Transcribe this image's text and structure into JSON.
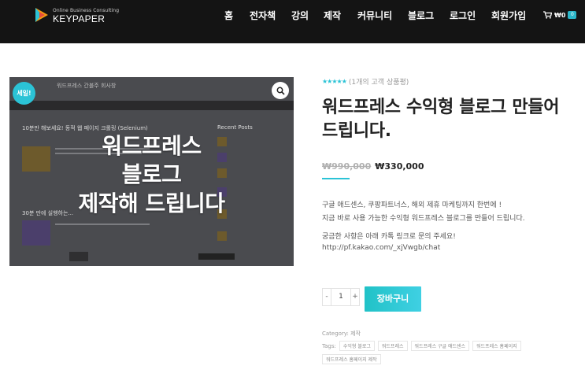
{
  "header": {
    "logo_tagline": "Online Business Consulting",
    "logo_name": "KEYPAPER",
    "nav": [
      "홈",
      "전자책",
      "강의",
      "제작",
      "커뮤니티",
      "블로그",
      "로그인",
      "회원가입"
    ],
    "cart_amount": "₩0",
    "cart_count": "0"
  },
  "product_image": {
    "sale_badge": "세일!",
    "overlay_lines": [
      "워드프레스",
      "블로그",
      "제작해 드립니다"
    ],
    "mock_title": "워드프레스 간블주 회사창",
    "mock_post1": "10분만 해보세요! 동적 웹 페이지 크롤링 (Selenium)",
    "mock_post2": "30분 만에 실행하는...",
    "mock_sidebar": "Recent Posts"
  },
  "product": {
    "rating_stars": "★★★★★",
    "review_link": "(1개의 고객 상품평)",
    "title": "워드프레스 수익형 블로그 만들어 드립니다.",
    "price_old": "₩990,000",
    "price_new": "₩330,000",
    "description": [
      "구글 애드센스, 쿠팡파트너스, 해외 제휴 마케팅까지 한번에 !",
      "지금 바로 사용 가능한 수익형 워드프레스 블로그를 만들어 드립니다.",
      "궁금한 사항은 아래 카톡 링크로 문의 주세요!",
      "http://pf.kakao.com/_xjVwgb/chat"
    ],
    "qty_minus": "-",
    "qty_value": "1",
    "qty_plus": "+",
    "add_to_cart": "장바구니",
    "category_label": "Category:",
    "category_value": "제작",
    "tags_label": "Tags:",
    "tags": [
      "수익형 블로그",
      "워드프레스",
      "워드프레스 구글 애드센스",
      "워드프레스 홈페이지",
      "워드프레스 홈페이지 제작"
    ]
  },
  "colors": {
    "accent": "#2bc3d6",
    "header_bg": "#141414"
  }
}
